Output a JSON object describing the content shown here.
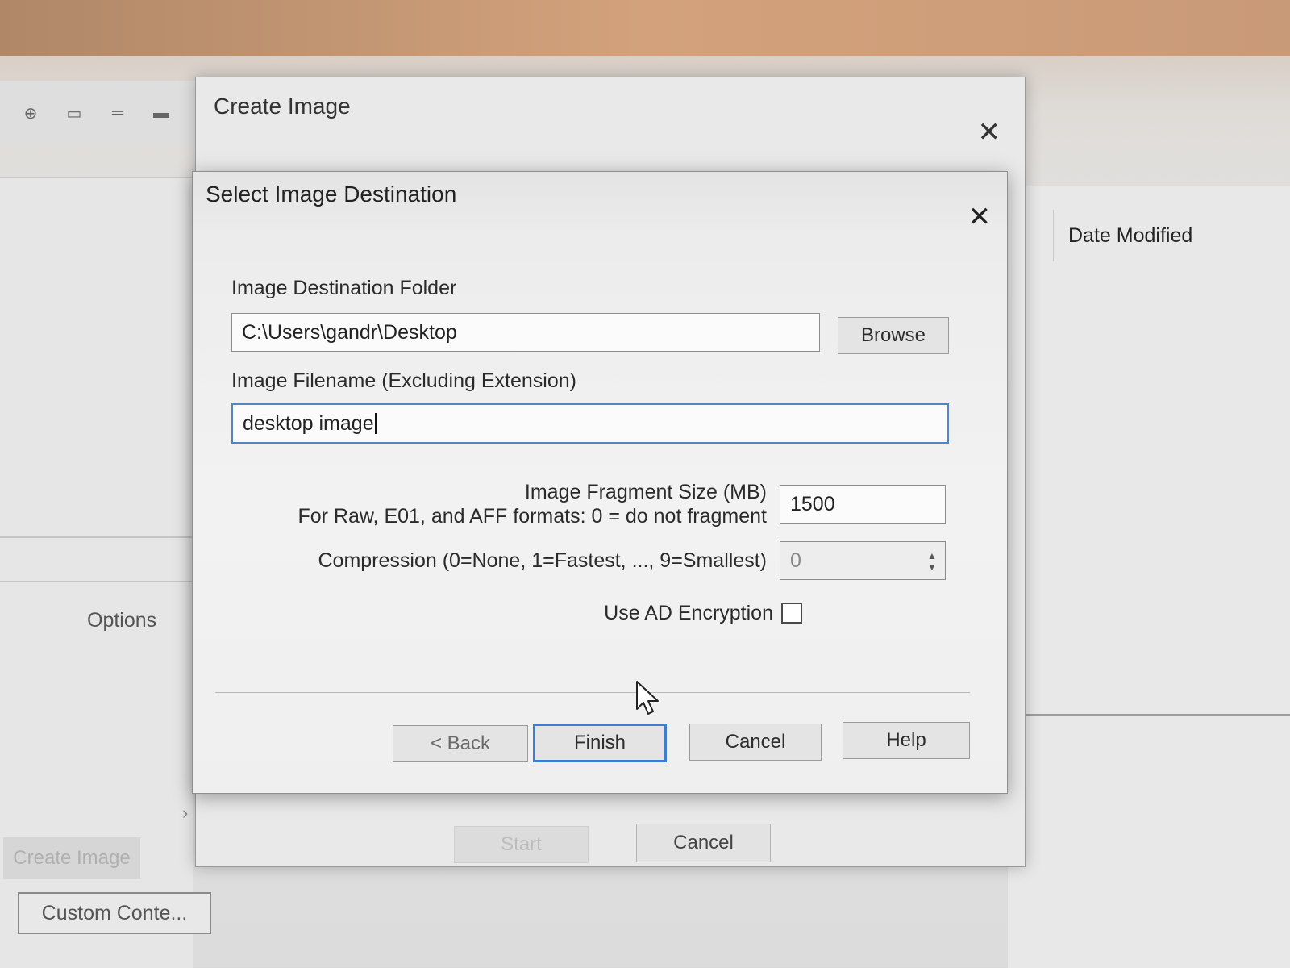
{
  "background": {
    "date_modified_header": "Date Modified",
    "options_label": "Options",
    "create_image_button": "Create Image",
    "custom_content_button": "Custom Conte..."
  },
  "parent_dialog": {
    "title": "Create Image",
    "close_glyph": "✕",
    "start_label": "Start",
    "cancel_label": "Cancel"
  },
  "dialog": {
    "title": "Select Image Destination",
    "close_glyph": "✕",
    "folder_label": "Image Destination Folder",
    "folder_value": "C:\\Users\\gandr\\Desktop",
    "browse_label": "Browse",
    "filename_label": "Image Filename (Excluding Extension)",
    "filename_value": "desktop image",
    "fragment_label_line1": "Image Fragment Size (MB)",
    "fragment_label_line2": "For Raw, E01, and AFF formats: 0 = do not fragment",
    "fragment_value": "1500",
    "compression_label": "Compression (0=None, 1=Fastest, ..., 9=Smallest)",
    "compression_value": "0",
    "encryption_label": "Use AD Encryption",
    "encryption_checked": false,
    "buttons": {
      "back": "< Back",
      "finish": "Finish",
      "cancel": "Cancel",
      "help": "Help"
    }
  },
  "colors": {
    "focus_border": "#3c7fd0"
  }
}
